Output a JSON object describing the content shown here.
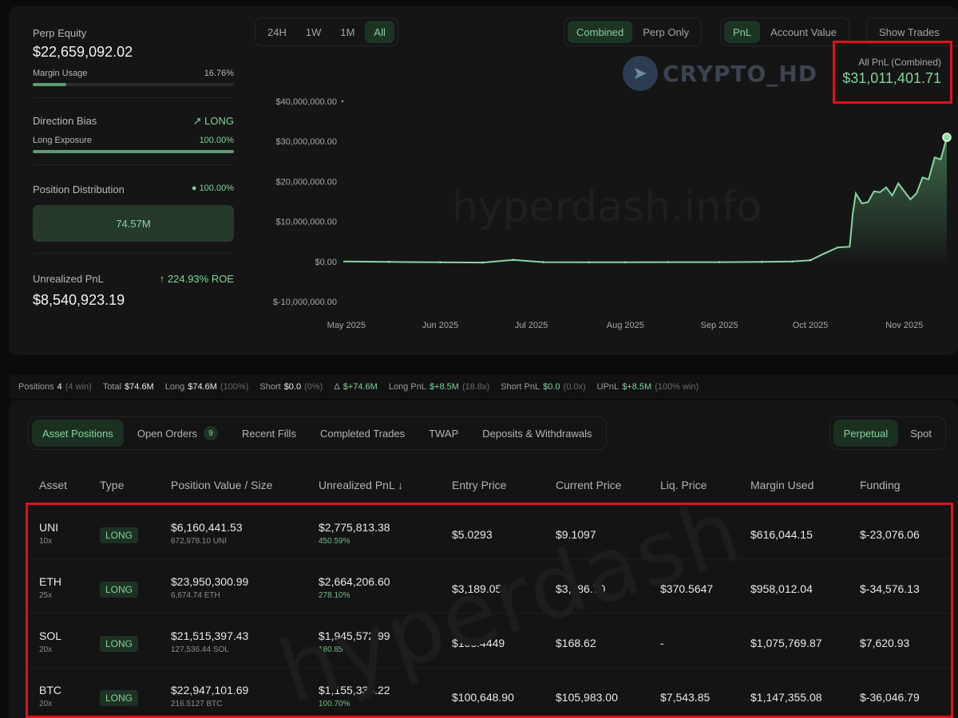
{
  "left": {
    "equity_label": "Perp Equity",
    "equity_value": "$22,659,092.02",
    "margin_label": "Margin Usage",
    "margin_value": "16.76%",
    "margin_fraction": 0.1676,
    "bias_label": "Direction Bias",
    "bias_value": "LONG",
    "exposure_label": "Long Exposure",
    "exposure_value": "100.00%",
    "exposure_fraction": 1.0,
    "dist_label": "Position Distribution",
    "dist_value": "100.00%",
    "dist_bar_value": "74.57M",
    "upnl_label": "Unrealized PnL",
    "upnl_roe": "224.93% ROE",
    "upnl_value": "$8,540,923.19"
  },
  "toolbar": {
    "ranges": [
      "24H",
      "1W",
      "1M",
      "All"
    ],
    "active_range": "All",
    "modes": [
      "Combined",
      "Perp Only"
    ],
    "active_mode": "Combined",
    "metrics": [
      "PnL",
      "Account Value"
    ],
    "active_metric": "PnL",
    "show_trades": "Show Trades"
  },
  "pnl_box": {
    "label": "All PnL (Combined)",
    "value": "$31,011,401.71"
  },
  "watermarks": {
    "top": "CRYPTO_HD",
    "chart": "hyperdash.info",
    "bottom": "hyperdash"
  },
  "chart_data": {
    "type": "area",
    "title": "",
    "xlabel": "",
    "ylabel": "",
    "ylim": [
      -10000000,
      40000000
    ],
    "y_ticks": [
      "$40,000,000.00",
      "$30,000,000.00",
      "$20,000,000.00",
      "$10,000,000.00",
      "$0.00",
      "$-10,000,000.00"
    ],
    "y_tick_values": [
      40000000,
      30000000,
      20000000,
      10000000,
      0,
      -10000000
    ],
    "x_ticks": [
      "May 2025",
      "Jun 2025",
      "Jul 2025",
      "Aug 2025",
      "Sep 2025",
      "Oct 2025",
      "Nov 2025"
    ],
    "x_range": [
      "2025-04-30",
      "2025-11-15"
    ],
    "series": [
      {
        "x": [
          "2025-04-30",
          "2025-05-15",
          "2025-06-01",
          "2025-06-15",
          "2025-06-25",
          "2025-07-05",
          "2025-07-20",
          "2025-08-01",
          "2025-08-15",
          "2025-09-01",
          "2025-09-15",
          "2025-09-25",
          "2025-10-01",
          "2025-10-05",
          "2025-10-10",
          "2025-10-14",
          "2025-10-15",
          "2025-10-16",
          "2025-10-18",
          "2025-10-20",
          "2025-10-22",
          "2025-10-24",
          "2025-10-26",
          "2025-10-28",
          "2025-10-30",
          "2025-11-01",
          "2025-11-03",
          "2025-11-05",
          "2025-11-07",
          "2025-11-09",
          "2025-11-11",
          "2025-11-13",
          "2025-11-15"
        ],
        "values": [
          0,
          -100000,
          -200000,
          -250000,
          400000,
          -150000,
          -200000,
          -200000,
          -150000,
          -150000,
          -100000,
          0,
          300000,
          1800000,
          3500000,
          3700000,
          12000000,
          17000000,
          14500000,
          14800000,
          17500000,
          17300000,
          18500000,
          16500000,
          19500000,
          17500000,
          15500000,
          17000000,
          21000000,
          20500000,
          26000000,
          25500000,
          31000000
        ]
      }
    ]
  },
  "summary": [
    {
      "label": "Positions",
      "value": "4",
      "extra": "(4 win)"
    },
    {
      "label": "Total",
      "value": "$74.6M",
      "extra": ""
    },
    {
      "label": "Long",
      "value": "$74.6M",
      "extra": "(100%)"
    },
    {
      "label": "Short",
      "value": "$0.0",
      "extra": "(0%)"
    },
    {
      "label": "Δ",
      "value": "$+74.6M",
      "extra": "",
      "green": true
    },
    {
      "label": "Long PnL",
      "value": "$+8.5M",
      "extra": "(18.8x)",
      "green": true
    },
    {
      "label": "Short PnL",
      "value": "$0.0",
      "extra": "(0.0x)",
      "green": true
    },
    {
      "label": "UPnL",
      "value": "$+8.5M",
      "extra": "(100% win)",
      "green": true
    }
  ],
  "tabs": {
    "items": [
      "Asset Positions",
      "Open Orders",
      "Recent Fills",
      "Completed Trades",
      "TWAP",
      "Deposits & Withdrawals"
    ],
    "active": "Asset Positions",
    "open_orders_count": "9",
    "markets": [
      "Perpetual",
      "Spot"
    ],
    "active_market": "Perpetual"
  },
  "table": {
    "headers": [
      "Asset",
      "Type",
      "Position Value / Size",
      "Unrealized PnL ↓",
      "Entry Price",
      "Current Price",
      "Liq. Price",
      "Margin Used",
      "Funding"
    ],
    "rows": [
      {
        "asset": "UNI",
        "lev": "10x",
        "type": "LONG",
        "value": "$6,160,441.53",
        "size": "672,978.10 UNI",
        "upnl": "$2,775,813.38",
        "upnl_pct": "450.59%",
        "entry": "$5.0293",
        "current": "$9.1097",
        "liq": "-",
        "margin": "$616,044.15",
        "funding": "$-23,076.06",
        "funding_positive": false
      },
      {
        "asset": "ETH",
        "lev": "25x",
        "type": "LONG",
        "value": "$23,950,300.99",
        "size": "6,674.74 ETH",
        "upnl": "$2,664,206.60",
        "upnl_pct": "278.10%",
        "entry": "$3,189.05",
        "current": "$3,586.70",
        "liq": "$370.5647",
        "margin": "$958,012.04",
        "funding": "$-34,576.13",
        "funding_positive": false
      },
      {
        "asset": "SOL",
        "lev": "20x",
        "type": "LONG",
        "value": "$21,515,397.43",
        "size": "127,536.44 SOL",
        "upnl": "$1,945,572.99",
        "upnl_pct": "180.85%",
        "entry": "$153.4449",
        "current": "$168.62",
        "liq": "-",
        "margin": "$1,075,769.87",
        "funding": "$7,620.93",
        "funding_positive": true
      },
      {
        "asset": "BTC",
        "lev": "20x",
        "type": "LONG",
        "value": "$22,947,101.69",
        "size": "216.5127 BTC",
        "upnl": "$1,155,330.22",
        "upnl_pct": "100.70%",
        "entry": "$100,648.90",
        "current": "$105,983.00",
        "liq": "$7,543.85",
        "margin": "$1,147,355.08",
        "funding": "$-36,046.79",
        "funding_positive": false
      }
    ]
  }
}
